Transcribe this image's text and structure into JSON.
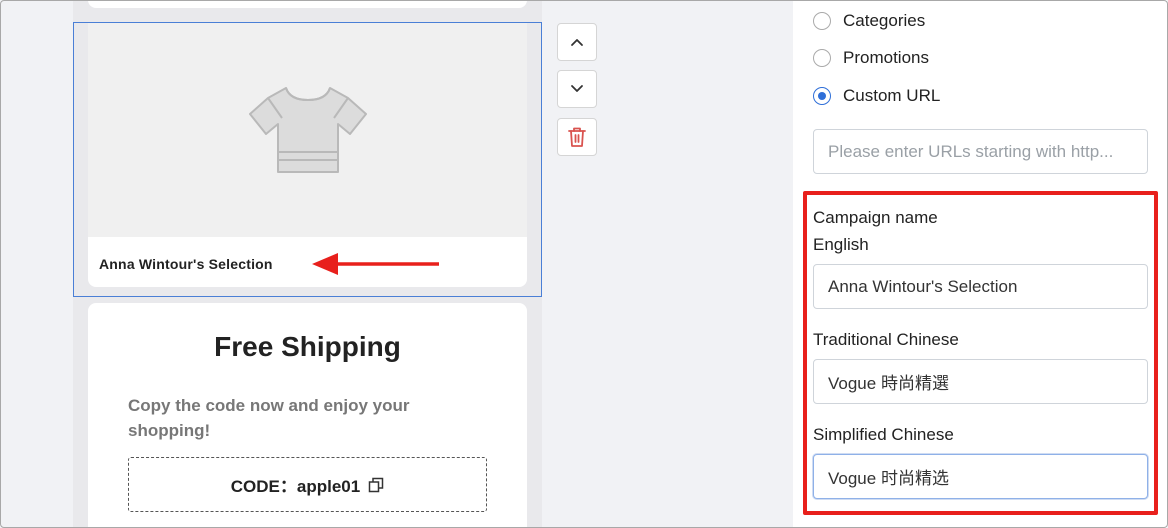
{
  "preview": {
    "product_name": "Anna Wintour's Selection",
    "shipping_title": "Free Shipping",
    "shipping_description": "Copy the code now and enjoy your shopping!",
    "code_label": "CODE：apple01"
  },
  "icons": {
    "product_placeholder": "tshirt-icon",
    "move_up": "chevron-up-icon",
    "move_down": "chevron-down-icon",
    "delete": "trash-icon",
    "copy": "copy-icon"
  },
  "link_type": {
    "options": [
      {
        "label": "Categories",
        "checked": false
      },
      {
        "label": "Promotions",
        "checked": false
      },
      {
        "label": "Custom URL",
        "checked": true
      }
    ],
    "url_placeholder": "Please enter URLs starting with http..."
  },
  "campaign": {
    "section_label": "Campaign name",
    "english_label": "English",
    "english_value": "Anna Wintour's Selection",
    "traditional_label": "Traditional Chinese",
    "traditional_value": "Vogue 時尚精選",
    "simplified_label": "Simplified Chinese",
    "simplified_value": "Vogue 时尚精选"
  },
  "colors": {
    "selection_border": "#4a7fd6",
    "annotation_red": "#e8201c",
    "radio_accent": "#2f6fd8",
    "delete_icon": "#d9534f"
  }
}
